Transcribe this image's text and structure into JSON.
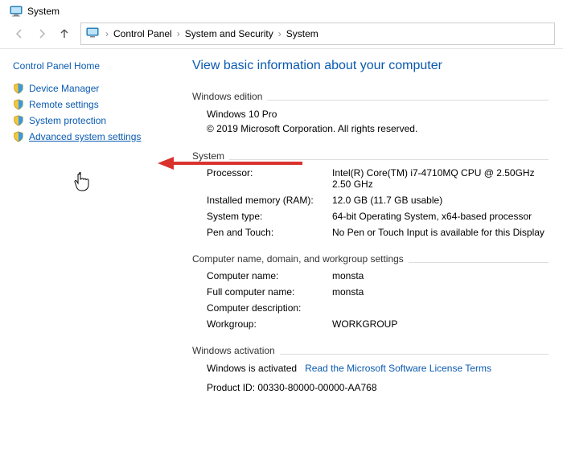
{
  "window": {
    "title": "System"
  },
  "breadcrumb": {
    "items": [
      "Control Panel",
      "System and Security",
      "System"
    ]
  },
  "sidebar": {
    "home": "Control Panel Home",
    "items": [
      {
        "label": "Device Manager"
      },
      {
        "label": "Remote settings"
      },
      {
        "label": "System protection"
      },
      {
        "label": "Advanced system settings"
      }
    ]
  },
  "main": {
    "heading": "View basic information about your computer",
    "edition": {
      "section": "Windows edition",
      "name": "Windows 10 Pro",
      "copyright": "© 2019 Microsoft Corporation. All rights reserved."
    },
    "system": {
      "section": "System",
      "rows": [
        {
          "label": "Processor:",
          "value": "Intel(R) Core(TM) i7-4710MQ CPU @ 2.50GHz   2.50 GHz"
        },
        {
          "label": "Installed memory (RAM):",
          "value": "12.0 GB (11.7 GB usable)"
        },
        {
          "label": "System type:",
          "value": "64-bit Operating System, x64-based processor"
        },
        {
          "label": "Pen and Touch:",
          "value": "No Pen or Touch Input is available for this Display"
        }
      ]
    },
    "naming": {
      "section": "Computer name, domain, and workgroup settings",
      "rows": [
        {
          "label": "Computer name:",
          "value": "monsta"
        },
        {
          "label": "Full computer name:",
          "value": "monsta"
        },
        {
          "label": "Computer description:",
          "value": ""
        },
        {
          "label": "Workgroup:",
          "value": "WORKGROUP"
        }
      ]
    },
    "activation": {
      "section": "Windows activation",
      "status": "Windows is activated",
      "link": "Read the Microsoft Software License Terms",
      "product_label": "Product ID:",
      "product_value": "00330-80000-00000-AA768"
    }
  }
}
